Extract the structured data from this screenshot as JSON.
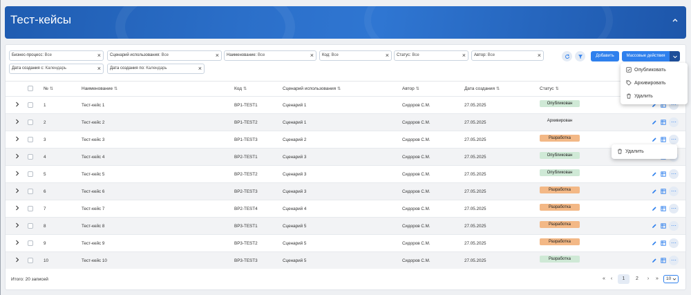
{
  "header": {
    "title": "Тест-кейсы"
  },
  "filters": [
    {
      "label": "Бизнес-процесс:",
      "value": "Все"
    },
    {
      "label": "Сценарий использования:",
      "value": "Все"
    },
    {
      "label": "Наименование:",
      "value": "Все"
    },
    {
      "label": "Код:",
      "value": "Все"
    },
    {
      "label": "Статус:",
      "value": "Все"
    },
    {
      "label": "Автор:",
      "value": "Все"
    },
    {
      "label": "Дата создания с:",
      "value": "Календарь"
    },
    {
      "label": "Дата создания по:",
      "value": "Календарь"
    }
  ],
  "toolbar": {
    "add_label": "Добавить",
    "mass_label": "Массовые действия"
  },
  "mass_menu": {
    "items": [
      "Опубликовать",
      "Архивировать",
      "Удалить"
    ]
  },
  "row_menu": {
    "items": [
      "Удалить"
    ]
  },
  "columns": [
    "№",
    "Наименование",
    "Код",
    "Сценарий использования",
    "Автор",
    "Дата создания",
    "Статус"
  ],
  "rows": [
    {
      "n": "1",
      "name": "Тест-кейс 1",
      "code": "BP1-TEST1",
      "scenario": "Сценарий 1",
      "author": "Сидоров С.М.",
      "date": "27.05.2025",
      "status": "Опубликован",
      "kind": "pub"
    },
    {
      "n": "2",
      "name": "Тест-кейс 2",
      "code": "BP1-TEST2",
      "scenario": "Сценарий 1",
      "author": "Сидоров С.М.",
      "date": "27.05.2025",
      "status": "Архивирован",
      "kind": "arc"
    },
    {
      "n": "3",
      "name": "Тест-кейс 3",
      "code": "BP1-TEST3",
      "scenario": "Сценарий 2",
      "author": "Сидоров С.М.",
      "date": "27.05.2025",
      "status": "Разработка",
      "kind": "dev"
    },
    {
      "n": "4",
      "name": "Тест-кейс 4",
      "code": "BP2-TEST1",
      "scenario": "Сценарий 3",
      "author": "Сидоров С.М.",
      "date": "27.05.2025",
      "status": "Опубликован",
      "kind": "pub"
    },
    {
      "n": "5",
      "name": "Тест-кейс 5",
      "code": "BP2-TEST2",
      "scenario": "Сценарий 3",
      "author": "Сидоров С.М.",
      "date": "27.05.2025",
      "status": "Опубликован",
      "kind": "pub"
    },
    {
      "n": "6",
      "name": "Тест-кейс 6",
      "code": "BP2-TEST3",
      "scenario": "Сценарий 3",
      "author": "Сидоров С.М.",
      "date": "27.05.2025",
      "status": "Разработка",
      "kind": "dev"
    },
    {
      "n": "7",
      "name": "Тест-кейс 7",
      "code": "BP2-TEST4",
      "scenario": "Сценарий 4",
      "author": "Сидоров С.М.",
      "date": "27.05.2025",
      "status": "Разработка",
      "kind": "dev"
    },
    {
      "n": "8",
      "name": "Тест-кейс 8",
      "code": "BP3-TEST1",
      "scenario": "Сценарий 5",
      "author": "Сидоров С.М.",
      "date": "27.05.2025",
      "status": "Разработка",
      "kind": "dev"
    },
    {
      "n": "9",
      "name": "Тест-кейс 9",
      "code": "BP3-TEST2",
      "scenario": "Сценарий 5",
      "author": "Сидоров С.М.",
      "date": "27.05.2025",
      "status": "Разработка",
      "kind": "dev"
    },
    {
      "n": "10",
      "name": "Тест-кейс 10",
      "code": "BP3-TEST3",
      "scenario": "Сценарий 5",
      "author": "Сидоров С.М.",
      "date": "27.05.2025",
      "status": "Разработка",
      "kind": "pub"
    }
  ],
  "footer": {
    "total": "Итого: 20 записей",
    "first": "«",
    "prev": "‹",
    "pages": [
      "1",
      "2"
    ],
    "next": "›",
    "last": "»",
    "page_size": "10"
  },
  "colors": {
    "accent": "#2f80ed",
    "published": "#cfe9d6",
    "development": "#f3b886",
    "header": "#2b6fc9"
  },
  "icons": [
    "chevron-up-icon",
    "refresh-icon",
    "filter-icon",
    "chevron-down-icon",
    "chevron-right-icon",
    "pencil-icon",
    "table-icon",
    "more-icon",
    "check-square-icon",
    "tag-icon",
    "trash-icon"
  ]
}
